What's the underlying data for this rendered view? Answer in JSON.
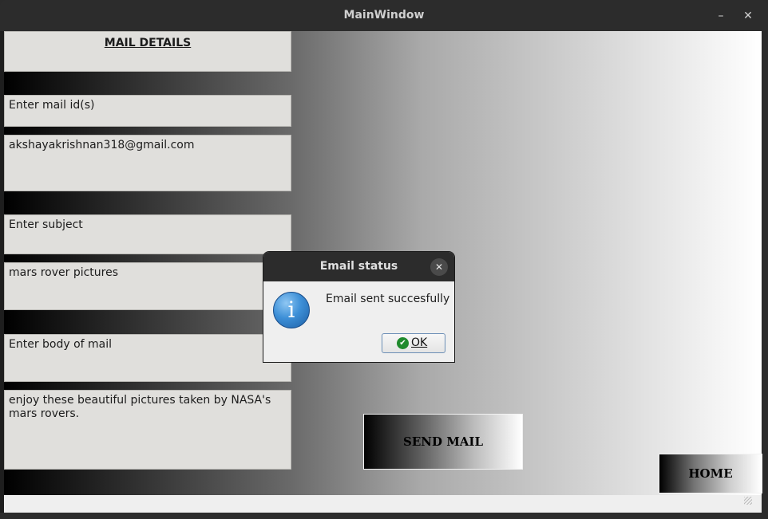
{
  "window": {
    "title": "MainWindow",
    "minimize_label": "–",
    "close_label": "✕"
  },
  "form": {
    "header": "MAIL DETAILS",
    "mail_id_label": "Enter mail id(s)",
    "mail_id_value": "akshayakrishnan318@gmail.com",
    "subject_label": "Enter subject",
    "subject_value": "mars rover pictures",
    "body_label": "Enter body of mail",
    "body_value": "enjoy these beautiful pictures taken by NASA's mars rovers."
  },
  "buttons": {
    "send": "SEND MAIL",
    "home": "HOME"
  },
  "dialog": {
    "title": "Email status",
    "close_label": "✕",
    "icon": "info-icon",
    "icon_glyph": "i",
    "message": "Email sent succesfully",
    "ok_label": "OK",
    "ok_icon_glyph": "✔"
  },
  "colors": {
    "titlebar": "#2c2c2c",
    "field_bg": "#e0dfdc",
    "ok_check": "#1f8a2c",
    "info_blue": "#3d8fd7"
  }
}
